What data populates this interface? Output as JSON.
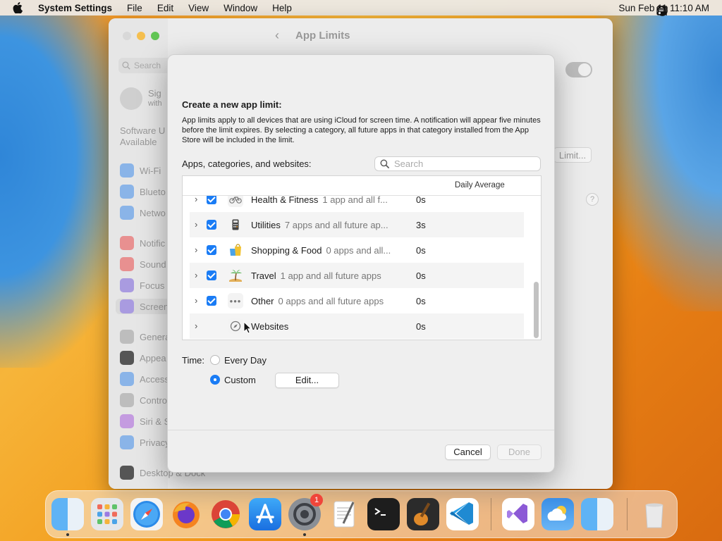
{
  "menubar": {
    "app_name": "System Settings",
    "menus": [
      "File",
      "Edit",
      "View",
      "Window",
      "Help"
    ],
    "clock": "Sun Feb 11  11:10 AM"
  },
  "settings_window": {
    "nav_title": "App Limits",
    "search_placeholder": "Search",
    "account_label": "Sig",
    "account_sub": "with",
    "update_label": "Software U",
    "update_sub": "Available",
    "sidebar_items": [
      "Wi-Fi",
      "Blueto",
      "Netwo",
      "Notific",
      "Sound",
      "Focus",
      "Screen",
      "Genera",
      "Appea",
      "Access",
      "Contro",
      "Siri & S",
      "Privacy",
      "Desktop & Dock"
    ],
    "limit_button": "Limit...",
    "help_label": "?"
  },
  "dialog": {
    "title": "Create a new app limit:",
    "description": "App limits apply to all devices that are using iCloud for screen time. A notification will appear five minutes before the limit expires. By selecting a category, all future apps in that category installed from the App Store will be included in the limit.",
    "list_label": "Apps, categories, and websites:",
    "search_placeholder": "Search",
    "column_header": "Daily Average",
    "rows": [
      {
        "name": "Health & Fitness",
        "sub": "1 app and all f...",
        "avg": "0s",
        "icon": "bicycle-icon",
        "checked": true
      },
      {
        "name": "Utilities",
        "sub": "7 apps and all future ap...",
        "avg": "3s",
        "icon": "calculator-icon",
        "checked": true
      },
      {
        "name": "Shopping & Food",
        "sub": "0 apps and all...",
        "avg": "0s",
        "icon": "shopping-bag-icon",
        "checked": true
      },
      {
        "name": "Travel",
        "sub": "1 app and all future apps",
        "avg": "0s",
        "icon": "palm-tree-icon",
        "checked": true
      },
      {
        "name": "Other",
        "sub": "0 apps and all future apps",
        "avg": "0s",
        "icon": "ellipsis-icon",
        "checked": true
      },
      {
        "name": "Websites",
        "sub": "",
        "avg": "0s",
        "icon": "compass-icon",
        "checked": false
      }
    ],
    "time_label": "Time:",
    "time_options": [
      "Every Day",
      "Custom"
    ],
    "selected_time": "Custom",
    "edit_button": "Edit...",
    "cancel_button": "Cancel",
    "done_button": "Done"
  },
  "dock": {
    "apps": [
      "Finder",
      "Launchpad",
      "Safari",
      "Firefox",
      "Chrome",
      "App Store",
      "System Settings",
      "TextEdit",
      "Terminal",
      "GarageBand",
      "VS Code",
      "Visual Studio",
      "Weather",
      "Finder",
      "Trash"
    ],
    "badge_count": "1"
  },
  "colors": {
    "accent": "#1a7cf5",
    "badge": "#f0453a"
  }
}
